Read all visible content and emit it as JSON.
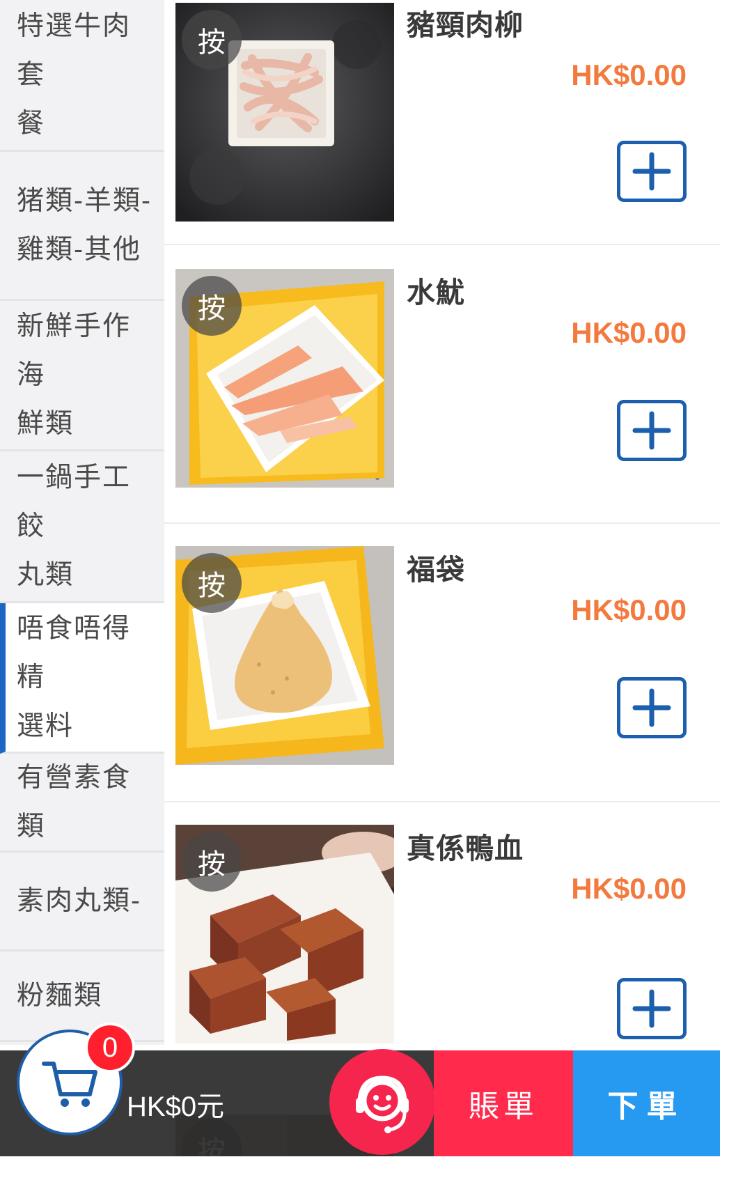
{
  "categories": [
    {
      "line1": "特選牛肉套",
      "line2": "餐"
    },
    {
      "line1": "猪類-羊類-",
      "line2": "雞類-其他"
    },
    {
      "line1": "新鮮手作海",
      "line2": "鮮類"
    },
    {
      "line1": "一鍋手工餃",
      "line2": "丸類"
    },
    {
      "line1": "唔食唔得精",
      "line2": "選料",
      "active": true
    },
    {
      "line1": "有營素食類",
      "line2": ""
    },
    {
      "line1": "素肉丸類-",
      "line2": ""
    },
    {
      "line1": "粉麵類",
      "line2": ""
    }
  ],
  "items": [
    {
      "name": "豬頸肉柳",
      "price": "HK$0.00",
      "press_label": "按"
    },
    {
      "name": "水魷",
      "price": "HK$0.00",
      "press_label": "按"
    },
    {
      "name": "福袋",
      "price": "HK$0.00",
      "press_label": "按"
    },
    {
      "name": "真係鴨血",
      "price": "HK$0.00",
      "press_label": "按"
    }
  ],
  "peek_item": {
    "press_label": "按"
  },
  "bottom_bar": {
    "cart_count": "0",
    "total": "HK$0元",
    "bill_label": "賬單",
    "order_label": "下單",
    "service_icon": "customer-service-icon",
    "cart_icon": "cart-icon"
  },
  "colors": {
    "price": "#f37a3e",
    "add_button_border": "#1c5fae",
    "active_category_bar": "#1e66c3",
    "bill_button": "#ff2a4c",
    "order_button": "#2699f0",
    "badge": "#ff1f2d"
  }
}
